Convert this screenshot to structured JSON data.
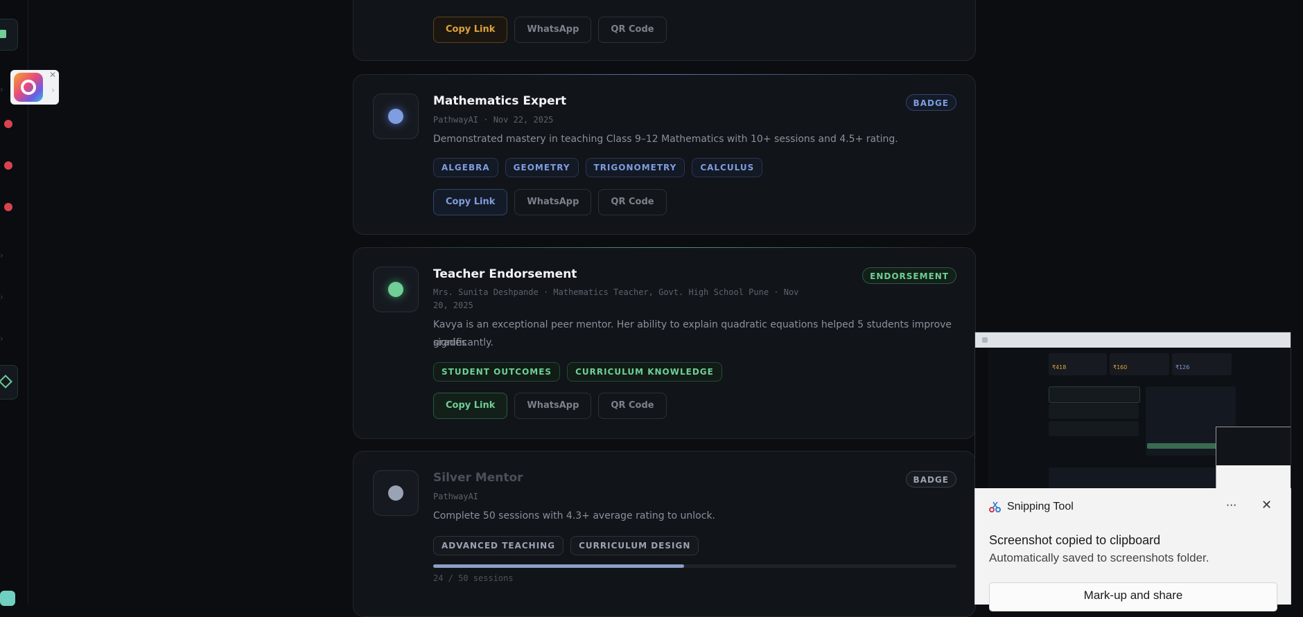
{
  "cards": {
    "top_buttons": {
      "copy": "Copy Link",
      "whatsapp": "WhatsApp",
      "qr": "QR Code"
    },
    "math": {
      "title": "Mathematics Expert",
      "meta": "PathwayAI · Nov 22, 2025",
      "desc": "Demonstrated mastery in teaching Class 9–12 Mathematics with 10+ sessions and 4.5+ rating.",
      "badge": "BADGE",
      "tags": [
        "ALGEBRA",
        "GEOMETRY",
        "TRIGONOMETRY",
        "CALCULUS"
      ],
      "buttons": {
        "copy": "Copy Link",
        "whatsapp": "WhatsApp",
        "qr": "QR Code"
      }
    },
    "endorse": {
      "title": "Teacher Endorsement",
      "meta_line1": "Mrs. Sunita Deshpande · Mathematics Teacher, Govt. High School Pune · Nov",
      "meta_line2": "20, 2025",
      "desc_line1": "Kavya is an exceptional peer mentor. Her ability to explain quadratic equations helped 5 students improve grades",
      "desc_line2": "significantly.",
      "badge": "ENDORSEMENT",
      "tags": [
        "STUDENT OUTCOMES",
        "CURRICULUM KNOWLEDGE"
      ],
      "buttons": {
        "copy": "Copy Link",
        "whatsapp": "WhatsApp",
        "qr": "QR Code"
      }
    },
    "silver": {
      "title": "Silver Mentor",
      "meta": "PathwayAI",
      "desc": "Complete 50 sessions with 4.3+ average rating to unlock.",
      "badge": "BADGE",
      "tags": [
        "ADVANCED TEACHING",
        "CURRICULUM DESIGN"
      ],
      "progress_fraction": 0.48,
      "progress_text": "24 / 50 sessions"
    }
  },
  "preview": {
    "stat1": "₹418",
    "stat2": "₹160",
    "stat3": "₹126"
  },
  "snipping_tool": {
    "app_name": "Snipping Tool",
    "more": "···",
    "close": "✕",
    "line1": "Screenshot copied to clipboard",
    "line2": "Automatically saved to screenshots folder.",
    "markup": "Mark-up and share"
  },
  "colors": {
    "accent_blue": "#7f9ddf",
    "accent_green": "#6fcf97",
    "accent_orange": "#e0a23a",
    "accent_gray": "#9aa3b4"
  },
  "icons": {
    "floating_app": "app-logo-icon",
    "snipping": "snipping-tool-icon"
  }
}
